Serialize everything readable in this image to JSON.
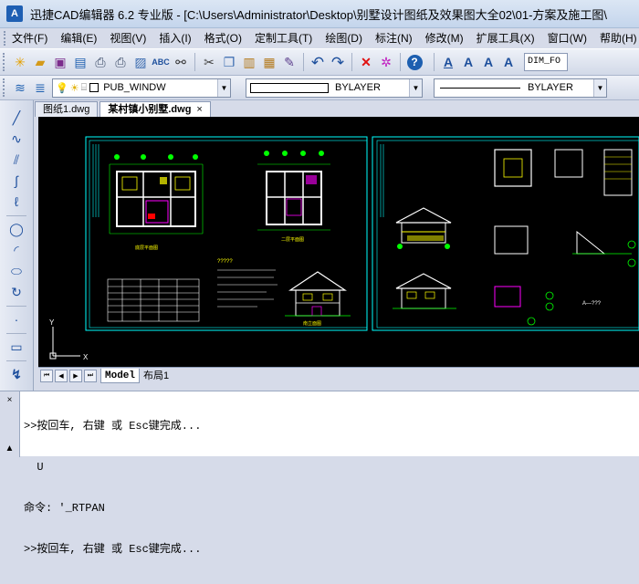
{
  "window": {
    "logo_text": "A",
    "title": "迅捷CAD编辑器 6.2 专业版  - [C:\\Users\\Administrator\\Desktop\\别墅设计图纸及效果图大全02\\01-方案及施工图\\"
  },
  "menu": [
    "文件(F)",
    "编辑(E)",
    "视图(V)",
    "插入(I)",
    "格式(O)",
    "定制工具(T)",
    "绘图(D)",
    "标注(N)",
    "修改(M)",
    "扩展工具(X)",
    "窗口(W)",
    "帮助(H)"
  ],
  "toolbar": {
    "dim_style": "DIM_FO"
  },
  "properties_bar": {
    "layer": "PUB_WINDW",
    "color": "BYLAYER",
    "linetype": "BYLAYER"
  },
  "doc_tabs": [
    {
      "label": "图纸1.dwg"
    },
    {
      "label": "某村镇小别墅.dwg",
      "close": "×"
    }
  ],
  "sheet_tabs": {
    "model": "Model",
    "layout": "布局1"
  },
  "canvas": {
    "axis_y": "Y",
    "axis_x": "X",
    "plan_label_1": "底层平面图",
    "plan_label_2": "二层平面图",
    "elev_label": "南立面图",
    "scale_note": "?????",
    "big_label": "A—???"
  },
  "command": {
    "lines": [
      ">>按回车, 右键 或 Esc键完成...",
      "  U",
      "命令: '_RTPAN",
      ">>按回车, 右键 或 Esc键完成..."
    ]
  },
  "colors": {
    "canvas_bg": "#000000",
    "frame": "#00ffff",
    "wall": "#ffffff",
    "dim": "#00ff00",
    "text": "#ffff00",
    "accent": "#ff00ff",
    "red": "#ff0000"
  }
}
